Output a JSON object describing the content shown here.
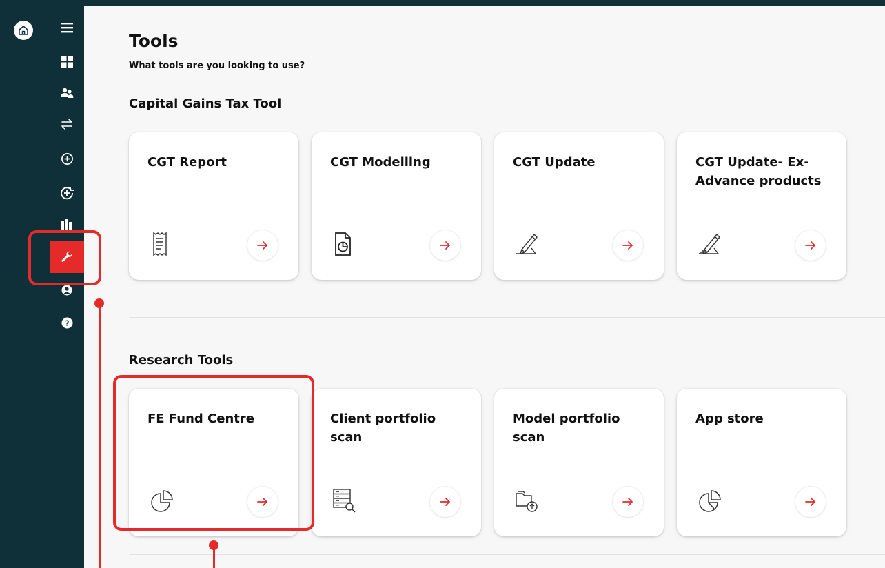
{
  "page": {
    "title": "Tools",
    "subtitle": "What tools are you looking to use?"
  },
  "sections": [
    {
      "title": "Capital Gains Tax Tool",
      "cards": [
        {
          "title": "CGT Report",
          "icon": "receipt-icon"
        },
        {
          "title": "CGT Modelling",
          "icon": "document-chart-icon"
        },
        {
          "title": "CGT Update",
          "icon": "edit-pen-icon"
        },
        {
          "title": "CGT Update- Ex-Advance products",
          "icon": "edit-pen-icon"
        }
      ]
    },
    {
      "title": "Research Tools",
      "cards": [
        {
          "title": "FE Fund Centre",
          "icon": "pie-chart-icon"
        },
        {
          "title": "Client portfolio scan",
          "icon": "server-search-icon"
        },
        {
          "title": "Model portfolio scan",
          "icon": "folder-upload-icon"
        },
        {
          "title": "App store",
          "icon": "pie-chart-icon"
        }
      ]
    }
  ],
  "sidebar": {
    "items": [
      {
        "name": "menu-icon"
      },
      {
        "name": "dashboard-icon"
      },
      {
        "name": "clients-icon"
      },
      {
        "name": "transfer-icon"
      },
      {
        "name": "add-icon"
      },
      {
        "name": "add-investment-icon"
      },
      {
        "name": "library-icon"
      },
      {
        "name": "tools-icon",
        "active": true
      },
      {
        "name": "account-icon"
      },
      {
        "name": "help-icon"
      }
    ]
  },
  "colors": {
    "sidebar_bg": "#0f3038",
    "accent": "#e52a2a",
    "main_bg": "#f7f7f7",
    "card_bg": "#ffffff"
  }
}
